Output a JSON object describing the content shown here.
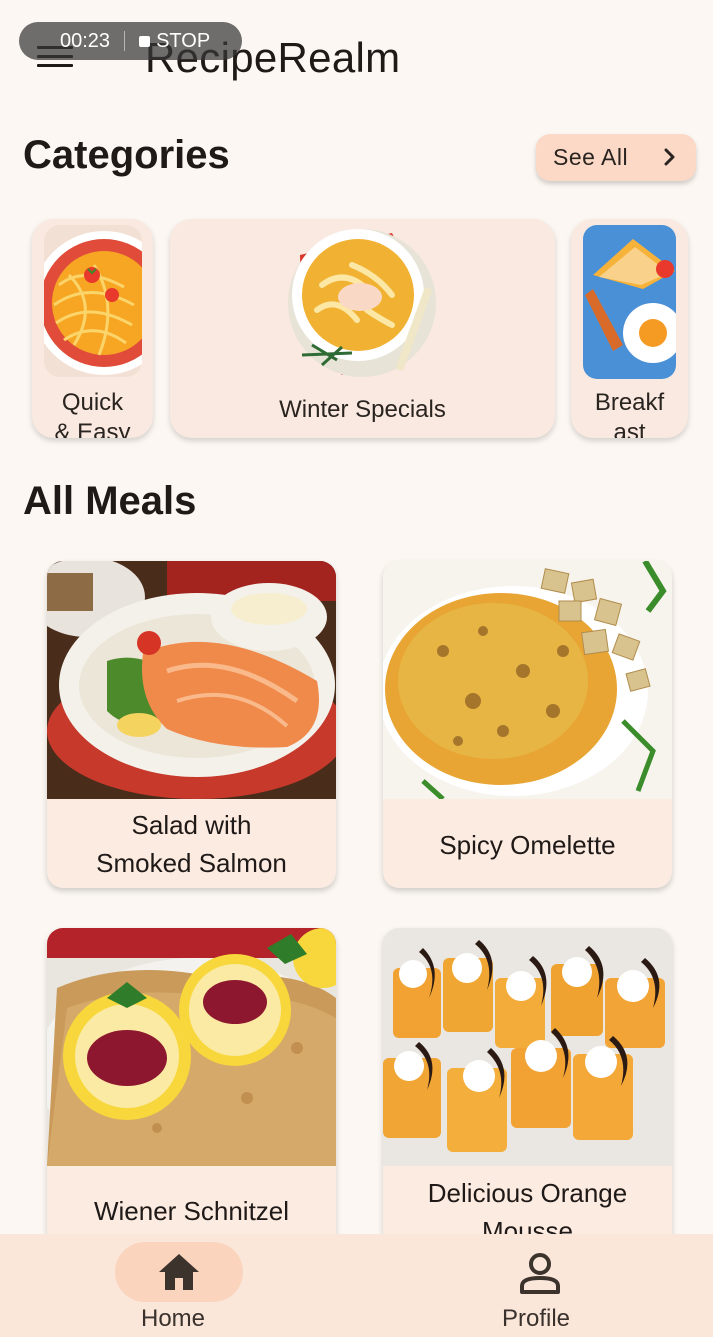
{
  "recording": {
    "time": "00:23",
    "stop_label": "STOP"
  },
  "app_bar": {
    "title": "RecipeRealm",
    "menu_icon": "menu-icon"
  },
  "categories": {
    "title": "Categories",
    "see_all_label": "See All",
    "items": [
      {
        "label": "Quick\n& Easy",
        "icon": "spaghetti-image"
      },
      {
        "label": "Winter Specials",
        "icon": "soup-bowl-image"
      },
      {
        "label": "Breakf\nast",
        "icon": "breakfast-image"
      }
    ]
  },
  "all_meals": {
    "title": "All Meals",
    "items": [
      {
        "name": "Salad with\nSmoked Salmon",
        "image": "salmon-salad-photo"
      },
      {
        "name": "Spicy Omelette",
        "image": "omelette-photo"
      },
      {
        "name": "Wiener Schnitzel",
        "image": "schnitzel-photo"
      },
      {
        "name": "Delicious Orange\nMousse",
        "image": "orange-mousse-photo"
      }
    ]
  },
  "bottom_nav": {
    "items": [
      {
        "label": "Home",
        "icon": "home-icon",
        "active": true
      },
      {
        "label": "Profile",
        "icon": "person-icon",
        "active": false
      }
    ]
  },
  "colors": {
    "background": "#fcf7f2",
    "card": "#f9e9e1",
    "accent": "#fbd9c6",
    "nav_active": "#fbd4bd"
  }
}
